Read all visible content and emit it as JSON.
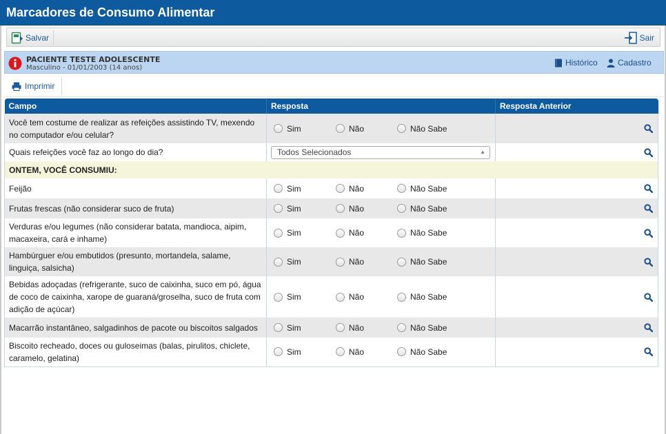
{
  "window": {
    "title": "Marcadores de Consumo Alimentar"
  },
  "toolbar": {
    "save_label": "Salvar",
    "exit_label": "Sair"
  },
  "patient": {
    "name": "PACIENTE TESTE ADOLESCENTE",
    "details": "Masculino - 01/01/2003 (14 anos)",
    "history_label": "Histórico",
    "register_label": "Cadastro"
  },
  "actions": {
    "print_label": "Imprimir"
  },
  "table": {
    "headers": {
      "field": "Campo",
      "answer": "Resposta",
      "previous": "Resposta Anterior"
    },
    "options": {
      "yes": "Sim",
      "no": "Não",
      "dont_know": "Não Sabe"
    },
    "questions": [
      "Você tem costume de realizar as refeições assistindo TV, mexendo no computador e/ou celular?",
      "Quais refeições você faz ao longo do dia?",
      "Feijão",
      "Frutas frescas (não considerar suco de fruta)",
      "Verduras e/ou legumes (não considerar batata, mandioca, aipim, macaxeira, cará e inhame)",
      "Hambúrguer e/ou embutidos (presunto, mortandela, salame, linguiça, salsicha)",
      "Bebidas adoçadas (refrigerante, suco de caixinha, suco em pó, água de coco de caixinha, xarope de guaraná/groselha, suco de fruta com adição de açúcar)",
      "Macarrão instantâneo, salgadinhos de pacote ou biscoitos salgados",
      "Biscoito recheado, doces ou guloseimas (balas, pirulitos, chiclete, caramelo, gelatina)"
    ],
    "meals_select_value": "Todos Selecionados",
    "section_label": "ONTEM, VOCÊ CONSUMIU:"
  },
  "colors": {
    "header_blue": "#0d5a9e",
    "patient_bg": "#bcd5f0",
    "section_bg": "#f5f5dc",
    "alert_red": "#d9181f"
  }
}
